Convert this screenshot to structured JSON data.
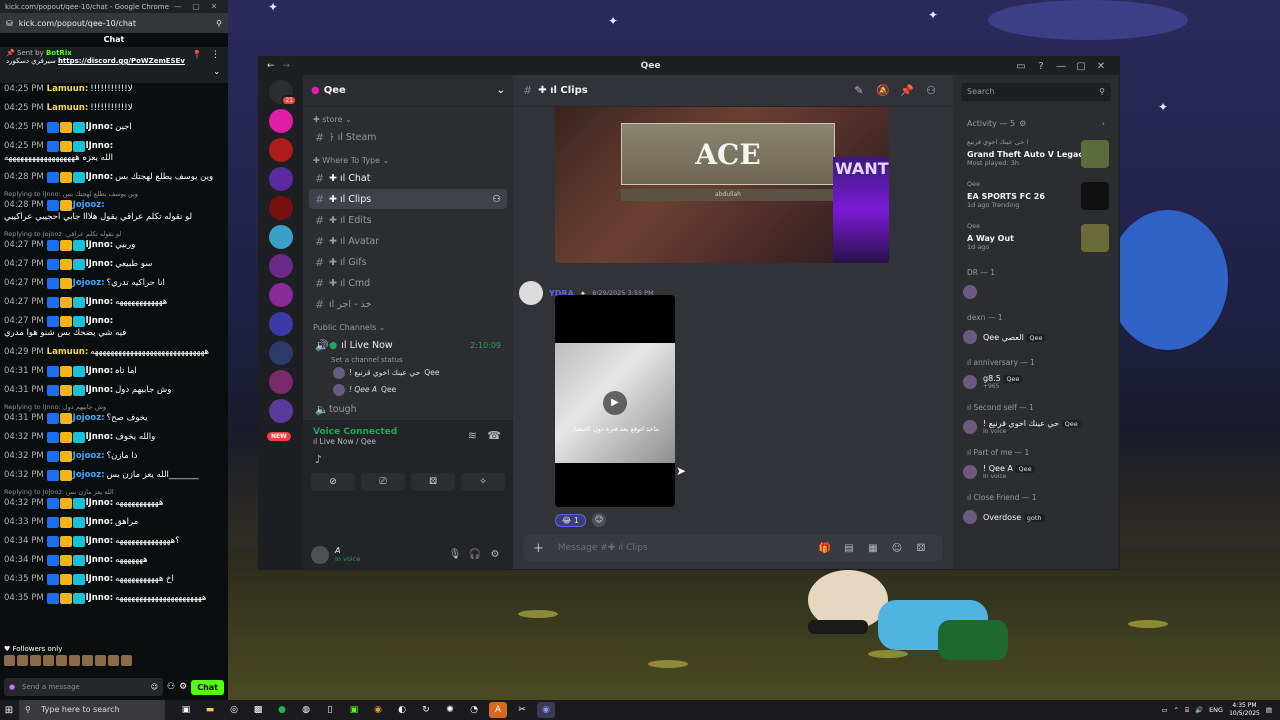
{
  "browser": {
    "title": "kick.com/popout/qee-10/chat - Google Chrome",
    "url": "kick.com/popout/qee-10/chat",
    "tab_label": "Chat"
  },
  "kick": {
    "pinned": {
      "sent_by": "Sent by",
      "bot": "BotRix",
      "text": "سيرفري دسكورد",
      "link": "https://discord.gg/PoWZemESEv"
    },
    "messages": [
      {
        "reply": "",
        "time": "04:25 PM",
        "user": "Lamuun:",
        "user_color": "#f2d94e",
        "badges": 0,
        "text": "!!!!!!!!!!!لا"
      },
      {
        "reply": "",
        "time": "04:25 PM",
        "user": "Lamuun:",
        "user_color": "#f2d94e",
        "badges": 0,
        "text": "!!!!!!!!!!!لا"
      },
      {
        "reply": "",
        "time": "04:25 PM",
        "user": "lJnno:",
        "user_color": "#ffffff",
        "badges": 3,
        "text": "اجين"
      },
      {
        "reply": "",
        "time": "04:25 PM",
        "user": "lJnno:",
        "user_color": "#ffffff",
        "badges": 3,
        "text": "الله يعزه ههههههههههههههههههه"
      },
      {
        "reply": "",
        "time": "04:28 PM",
        "user": "lJnno:",
        "user_color": "#ffffff",
        "badges": 3,
        "text": "وين يوسف يطلع لهجتك بس"
      },
      {
        "reply": "Replying to lJnno: وين يوسف يطلع لهجتك بس",
        "time": "04:28 PM",
        "user": "Jojooz:",
        "user_color": "#3aa8ff",
        "badges": 2,
        "text": "لو نقوله تكلم عراقي يقول هلااا جابي احجيبي عراكيبي"
      },
      {
        "reply": "Replying to Jojooz: لو نقوله تكلم عراقي",
        "time": "04:27 PM",
        "user": "lJnno:",
        "user_color": "#ffffff",
        "badges": 3,
        "text": "وربيي"
      },
      {
        "reply": "",
        "time": "04:27 PM",
        "user": "lJnno:",
        "user_color": "#ffffff",
        "badges": 3,
        "text": "سو طبيعي"
      },
      {
        "reply": "",
        "time": "04:27 PM",
        "user": "Jojooz:",
        "user_color": "#3aa8ff",
        "badges": 2,
        "text": "انا حراكيه تدري؟"
      },
      {
        "reply": "",
        "time": "04:27 PM",
        "user": "lJnno:",
        "user_color": "#ffffff",
        "badges": 3,
        "text": "ههههههههههههه"
      },
      {
        "reply": "",
        "time": "04:27 PM",
        "user": "lJnno:",
        "user_color": "#ffffff",
        "badges": 3,
        "text": "فيه شي يضحك بس شنو هوا مدري"
      },
      {
        "reply": "",
        "time": "04:29 PM",
        "user": "Lamuun:",
        "user_color": "#f2d94e",
        "badges": 0,
        "text": "هههههههههههههههههههههههههههههه"
      },
      {
        "reply": "",
        "time": "04:31 PM",
        "user": "lJnno:",
        "user_color": "#ffffff",
        "badges": 3,
        "text": "اما تاه"
      },
      {
        "reply": "",
        "time": "04:31 PM",
        "user": "lJnno:",
        "user_color": "#ffffff",
        "badges": 3,
        "text": "وش جابيهم دول"
      },
      {
        "reply": "Replying to lJnno: وش جابيهم دول",
        "time": "04:31 PM",
        "user": "Jojooz:",
        "user_color": "#3aa8ff",
        "badges": 2,
        "text": "يخوف صح؟"
      },
      {
        "reply": "",
        "time": "04:32 PM",
        "user": "lJnno:",
        "user_color": "#ffffff",
        "badges": 3,
        "text": "والله يخوف"
      },
      {
        "reply": "",
        "time": "04:32 PM",
        "user": "Jojooz:",
        "user_color": "#3aa8ff",
        "badges": 2,
        "text": "ذا مازن؟"
      },
      {
        "reply": "",
        "time": "04:32 PM",
        "user": "Jojooz:",
        "user_color": "#3aa8ff",
        "badges": 2,
        "text": "الله يعز مازن بس_______"
      },
      {
        "reply": "Replying to Jojooz: الله يعز مازن بس",
        "time": "04:32 PM",
        "user": "lJnno:",
        "user_color": "#ffffff",
        "badges": 3,
        "text": "هههههههههههه"
      },
      {
        "reply": "",
        "time": "04:33 PM",
        "user": "lJnno:",
        "user_color": "#ffffff",
        "badges": 3,
        "text": "مراهق"
      },
      {
        "reply": "",
        "time": "04:34 PM",
        "user": "lJnno:",
        "user_color": "#ffffff",
        "badges": 3,
        "text": "؟ههههههههههههههه"
      },
      {
        "reply": "",
        "time": "04:34 PM",
        "user": "lJnno:",
        "user_color": "#ffffff",
        "badges": 3,
        "text": "هههههههه"
      },
      {
        "reply": "",
        "time": "04:35 PM",
        "user": "lJnno:",
        "user_color": "#ffffff",
        "badges": 3,
        "text": "اخ هههههههههههه"
      },
      {
        "reply": "",
        "time": "04:35 PM",
        "user": "lJnno:",
        "user_color": "#ffffff",
        "badges": 3,
        "text": "ههههههههههههههههههههههه"
      }
    ],
    "followers_only": "Followers only",
    "input_placeholder": "Send a message",
    "send_label": "Chat"
  },
  "discord": {
    "window_title": "Qee",
    "server_name": "Qee",
    "categories": {
      "store": "store",
      "where_to_type": "Where To Type",
      "public_channels": "Public Channels"
    },
    "channels": [
      {
        "label": "﴿ ıl Steam",
        "active": false,
        "bright": false
      },
      {
        "label": "✚ ıl Chat",
        "active": false,
        "bright": true
      },
      {
        "label": "✚ ıl Clips",
        "active": true,
        "bright": true
      },
      {
        "label": "✚ ıl Edits",
        "active": false,
        "bright": false
      },
      {
        "label": "✚ ıl Avatar",
        "active": false,
        "bright": false
      },
      {
        "label": "✚ ıl Gifs",
        "active": false,
        "bright": false
      },
      {
        "label": "✚ ıl Cmd",
        "active": false,
        "bright": false
      },
      {
        "label": "ıl خذ - اجر",
        "active": false,
        "bright": false
      }
    ],
    "live_channel": {
      "label": "ıl Live Now",
      "timer": "2:10:09",
      "status": "Set a channel status"
    },
    "voice_users": [
      {
        "name": "! حي عينك اخوي قرنيع",
        "tag": "Qee"
      },
      {
        "name": "! Qee A",
        "tag": "Qee"
      }
    ],
    "tough_channel": "tough",
    "voice": {
      "connected": "Voice Connected",
      "where": "ıl Live Now / Qee"
    },
    "user": {
      "name": "A",
      "status": "In voice"
    },
    "current_channel": "✚ ıl Clips",
    "message": {
      "username": "YDRA",
      "timestamp": "8/29/2025 3:55 PM",
      "image_title": "ACE",
      "image_subtitle": "abdullah",
      "image_banner": "WANT",
      "video_caption": "بتاخذ اتوقع بعد فترة دون الانتصار"
    },
    "reaction_count": "1",
    "composer_placeholder": "Message #✚ ıl Clips",
    "search_placeholder": "Search",
    "activity": {
      "header": "Activity — 5",
      "items": [
        {
          "user": "حي عينك اخوي قرنيع !",
          "game": "Grand Theft Auto V Legacy",
          "meta1": "Most played: 3h",
          "meta2": "",
          "thumb": "#5b6b3b"
        },
        {
          "user": "Qee",
          "game": "EA SPORTS FC 26",
          "meta1": "1d ago",
          "meta2": "Trending",
          "thumb": "#101010"
        },
        {
          "user": "Qee",
          "game": "A Way Out",
          "meta1": "1d ago",
          "meta2": "",
          "thumb": "#6b6a3a"
        }
      ]
    },
    "member_sections": [
      {
        "title": "DR — 1",
        "members": [
          {
            "name": "",
            "tag": "",
            "sub": ""
          }
        ]
      },
      {
        "title": "dexn — 1",
        "members": [
          {
            "name": "Qee العصي",
            "tag": "Qee",
            "sub": ""
          }
        ]
      },
      {
        "title": "ıl anniversary — 1",
        "members": [
          {
            "name": "g8.5",
            "tag": "Qee",
            "sub": "+965"
          }
        ]
      },
      {
        "title": "ıl Second self — 1",
        "members": [
          {
            "name": "! حي عينك اخوي قرنيع",
            "tag": "Qee",
            "sub": "In voice"
          }
        ]
      },
      {
        "title": "ıl Part of me — 1",
        "members": [
          {
            "name": "! Qee A",
            "tag": "Qee",
            "sub": "In voice"
          }
        ]
      },
      {
        "title": "ıl Close Friend — 1",
        "members": [
          {
            "name": "Overdose",
            "tag": "goth",
            "sub": ""
          }
        ]
      }
    ]
  },
  "taskbar": {
    "search_placeholder": "Type here to search",
    "lang": "ENG",
    "time": "4:35 PM",
    "date": "10/5/2025"
  }
}
